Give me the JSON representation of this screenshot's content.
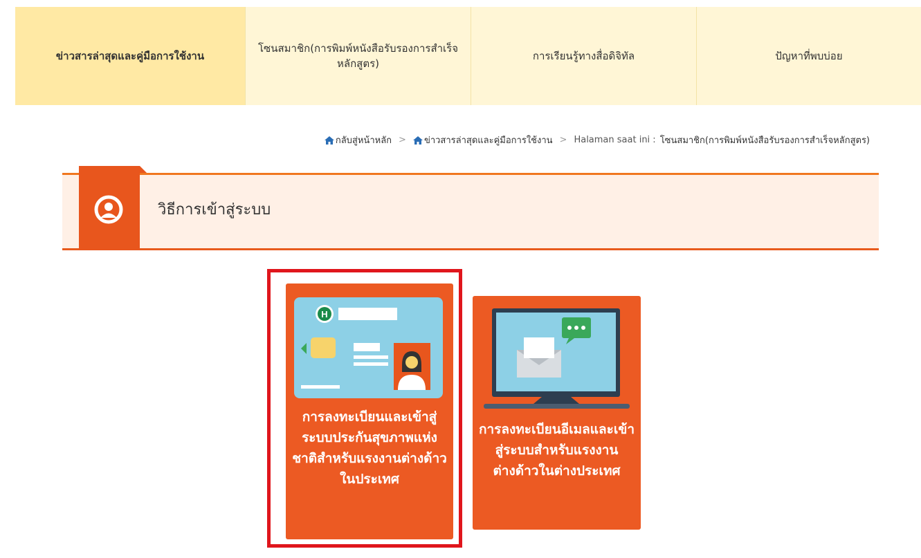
{
  "nav": {
    "tabs": [
      {
        "label": "ข่าวสารล่าสุดและคู่มือการใช้งาน"
      },
      {
        "label": "โซนสมาชิก(การพิมพ์หนังสือรับรองการสำเร็จหลักสูตร)"
      },
      {
        "label": "การเรียนรู้ทางสื่อดิจิทัล"
      },
      {
        "label": "ปัญหาที่พบบ่อย"
      }
    ]
  },
  "breadcrumb": {
    "home": "กลับสู่หน้าหลัก",
    "section": "ข่าวสารล่าสุดและคู่มือการใช้งาน",
    "current_prefix": "Halaman saat ini :",
    "current": "โซนสมาชิก(การพิมพ์หนังสือรับรองการสำเร็จหลักสูตร)",
    "separator": ">"
  },
  "section": {
    "title": "วิธีการเข้าสู่ระบบ"
  },
  "cards": [
    {
      "label": "การลงทะเบียนและเข้าสู่ระบบประกันสุขภาพแห่งชาติสำหรับแรงงานต่างด้าวในประเทศ"
    },
    {
      "label": "การลงทะเบียนอีเมลและเข้าสู่ระบบสำหรับแรงงานต่างด้าวในต่างประเทศ"
    }
  ],
  "colors": {
    "accent": "#ec5a23",
    "nav_bg": "#fff6d6",
    "nav_active": "#ffe9a4",
    "section_bg": "#fff0e6",
    "highlight": "#e0161c"
  }
}
